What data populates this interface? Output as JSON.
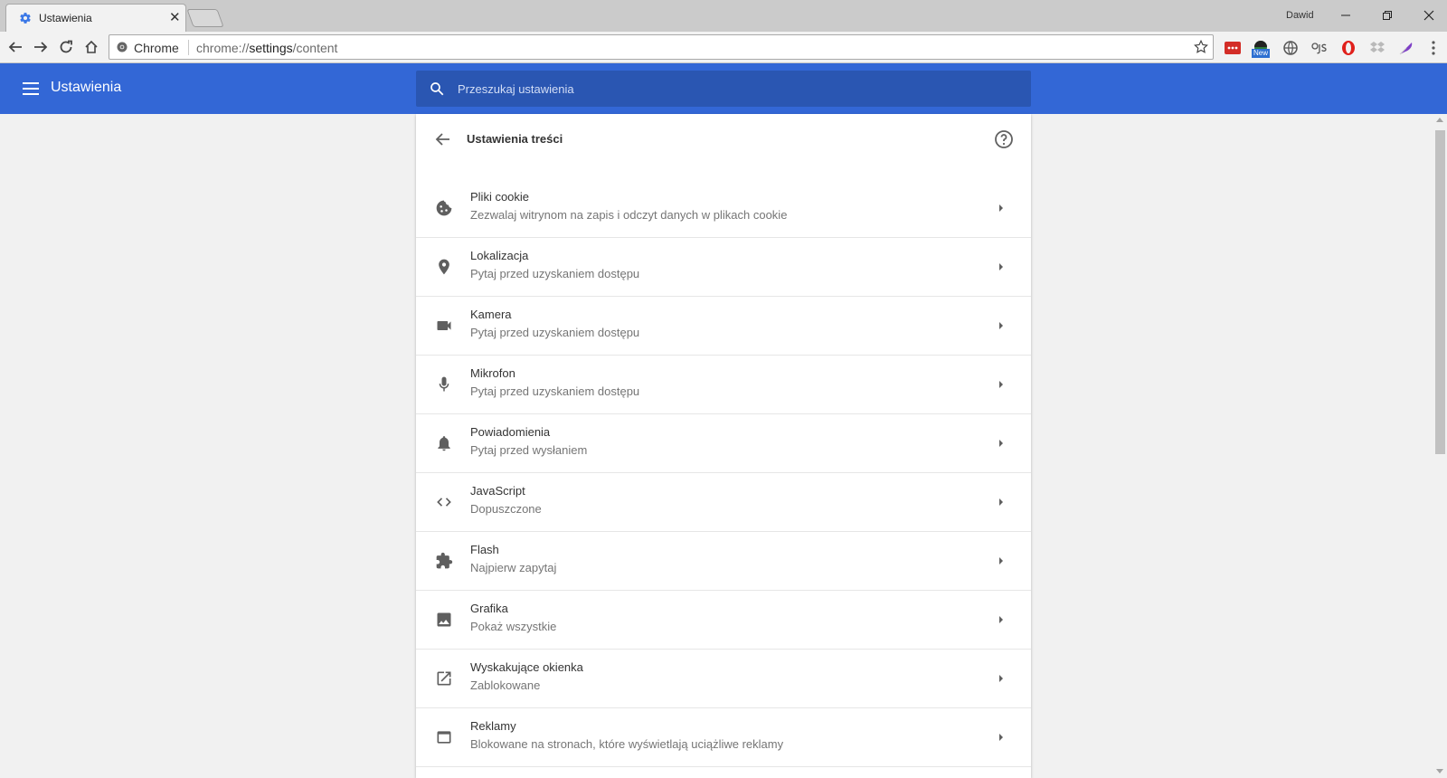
{
  "window": {
    "tab_title": "Ustawienia",
    "user_name": "Dawid"
  },
  "toolbar": {
    "site_chip": "Chrome",
    "url_scheme": "chrome://",
    "url_host": "settings",
    "url_path": "/content",
    "extension_badge": "New"
  },
  "header": {
    "title": "Ustawienia",
    "search_placeholder": "Przeszukaj ustawienia"
  },
  "page": {
    "title": "Ustawienia treści"
  },
  "settings": [
    {
      "label": "Pliki cookie",
      "sub": "Zezwalaj witrynom na zapis i odczyt danych w plikach cookie",
      "icon": "cookie-icon"
    },
    {
      "label": "Lokalizacja",
      "sub": "Pytaj przed uzyskaniem dostępu",
      "icon": "location-pin-icon"
    },
    {
      "label": "Kamera",
      "sub": "Pytaj przed uzyskaniem dostępu",
      "icon": "camera-icon"
    },
    {
      "label": "Mikrofon",
      "sub": "Pytaj przed uzyskaniem dostępu",
      "icon": "microphone-icon"
    },
    {
      "label": "Powiadomienia",
      "sub": "Pytaj przed wysłaniem",
      "icon": "bell-icon"
    },
    {
      "label": "JavaScript",
      "sub": "Dopuszczone",
      "icon": "code-icon"
    },
    {
      "label": "Flash",
      "sub": "Najpierw zapytaj",
      "icon": "puzzle-icon"
    },
    {
      "label": "Grafika",
      "sub": "Pokaż wszystkie",
      "icon": "image-icon"
    },
    {
      "label": "Wyskakujące okienka",
      "sub": "Zablokowane",
      "icon": "open-in-new-icon"
    },
    {
      "label": "Reklamy",
      "sub": "Blokowane na stronach, które wyświetlają uciążliwe reklamy",
      "icon": "ads-window-icon"
    }
  ],
  "colors": {
    "header_bg": "#3367d6",
    "search_bg": "#2a56b2",
    "page_bg": "#f1f1f1"
  }
}
